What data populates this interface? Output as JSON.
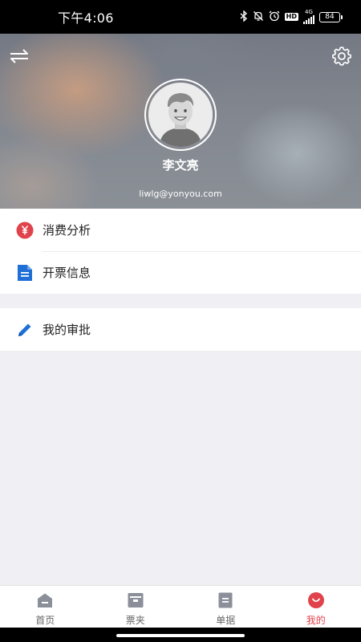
{
  "status_bar": {
    "time": "下午4:06",
    "network": "4G",
    "hd": "HD",
    "battery": "84",
    "icons": [
      "bluetooth-icon",
      "mute-bell-icon",
      "alarm-icon",
      "hd-icon",
      "signal-icon",
      "battery-icon"
    ]
  },
  "header": {
    "left_icon": "switch-arrows-icon",
    "right_icon": "settings-gear-icon",
    "user_name": "李文亮",
    "email": "liwlg@yonyou.com"
  },
  "menu": {
    "group1": [
      {
        "label": "消费分析",
        "icon": "yen-circle-icon",
        "color": "#e0434c"
      },
      {
        "label": "开票信息",
        "icon": "document-icon",
        "color": "#1f6fd6"
      }
    ],
    "group2": [
      {
        "label": "我的审批",
        "icon": "pencil-icon",
        "color": "#1f6fd6"
      }
    ]
  },
  "tabs": [
    {
      "label": "首页",
      "icon": "home-icon",
      "active": false
    },
    {
      "label": "票夹",
      "icon": "ticket-folder-icon",
      "active": false
    },
    {
      "label": "单据",
      "icon": "receipt-icon",
      "active": false
    },
    {
      "label": "我的",
      "icon": "profile-smile-icon",
      "active": true
    }
  ],
  "colors": {
    "accent": "#e0434c",
    "blue": "#1f6fd6",
    "tab_icon": "#8a8f99",
    "background": "#efeff4"
  }
}
